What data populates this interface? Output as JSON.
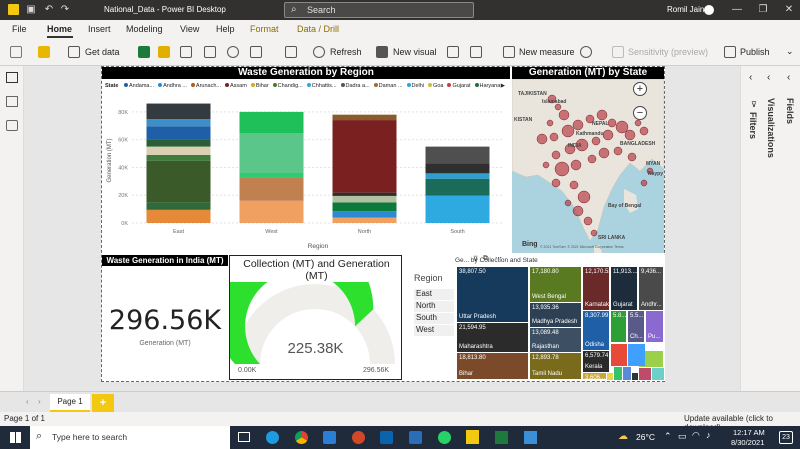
{
  "titlebar": {
    "title": "National_Data - Power BI Desktop",
    "search": "Search",
    "user": "Romil Jain"
  },
  "ribbon_tabs": [
    "File",
    "Home",
    "Insert",
    "Modeling",
    "View",
    "Help",
    "Format",
    "Data / Drill"
  ],
  "ribbon": {
    "get_data": "Get data",
    "refresh": "Refresh",
    "new_visual": "New visual",
    "new_measure": "New measure",
    "sensitivity": "Sensitivity (preview)",
    "publish": "Publish"
  },
  "panes": {
    "filters": "Filters",
    "visualizations": "Visualizations",
    "fields": "Fields"
  },
  "bar_visual": {
    "title": "Waste Generation by Region",
    "legend_label": "State",
    "legend_items": [
      "Andama...",
      "Andhra ...",
      "Arunach...",
      "Assam",
      "Bihar",
      "Chandig...",
      "Chhattis...",
      "Dadra a...",
      "Daman ...",
      "Delhi",
      "Goa",
      "Gujarat",
      "Haryana"
    ],
    "ylabel": "Generation (MT)",
    "xlabel": "Region",
    "yticks": [
      "80K",
      "60K",
      "40K",
      "20K",
      "0K"
    ]
  },
  "chart_data": {
    "type": "bar",
    "stacked": true,
    "categories": [
      "East",
      "West",
      "North",
      "South"
    ],
    "values": [
      86000,
      80000,
      78000,
      55000
    ],
    "ylim": [
      0,
      90000
    ],
    "xlabel": "Region",
    "ylabel": "Generation (MT)",
    "grid": true,
    "legend": "top"
  },
  "map_visual": {
    "title": "Generation (MT) by State",
    "labels": [
      "TAJIKISTAN",
      "KISTAN",
      "Islamabad",
      "NEPAL",
      "Kathmandu",
      "INDIA",
      "BANGLADESH",
      "MYAN",
      "Naypy",
      "Bay of Bengal",
      "SRI LANKA"
    ],
    "attribution": "© 2021 TomTom, © 2021 Microsoft Corporation Terms",
    "bing": "Bing",
    "zoom_in": "+",
    "zoom_out": "−"
  },
  "card_visual": {
    "title": "Waste Generation in India (MT)",
    "value": "296.56K",
    "label": "Generation (MT)"
  },
  "gauge_visual": {
    "title": "Collection (MT) and Generation (MT)",
    "value": "225.38K",
    "min": "0.00K",
    "max": "296.56K",
    "fraction": 0.76
  },
  "slicer": {
    "title": "Region",
    "items": [
      "East",
      "North",
      "South",
      "West"
    ]
  },
  "treemap_visual": {
    "title": "Ge... by Collection and State",
    "tiles": [
      {
        "value": "38,807.50",
        "label": "Uttar Pradesh",
        "color": "#163a5c"
      },
      {
        "value": "21,594.95",
        "label": "Maharashtra",
        "color": "#2b2b2b"
      },
      {
        "value": "18,813.80",
        "label": "Bihar",
        "color": "#7a4a2a"
      },
      {
        "value": "17,180.80",
        "label": "West Bengal",
        "color": "#5a7a22"
      },
      {
        "value": "13,935.36",
        "label": "Madhya Pradesh",
        "color": "#2e4154"
      },
      {
        "value": "13,089.48",
        "label": "Rajasthan",
        "color": "#3c4f63"
      },
      {
        "value": "12,893.78",
        "label": "Tamil Nadu",
        "color": "#7a6a1c"
      },
      {
        "value": "12,170.53",
        "label": "Karnataka",
        "color": "#6b2a2a"
      },
      {
        "value": "11,913....",
        "label": "Gujarat",
        "color": "#1d2c3a"
      },
      {
        "value": "9,436...",
        "label": "Andhr...",
        "color": "#4a4a4a"
      },
      {
        "value": "8,307.99",
        "label": "Odisha",
        "color": "#1f5fa8"
      },
      {
        "value": "6,579.74",
        "label": "Kerala",
        "color": "#2a2a2a"
      },
      {
        "value": "5.8...",
        "label": "",
        "color": "#2e9e36"
      },
      {
        "value": "5.5...",
        "label": "Ch...",
        "color": "#5a5a8a"
      },
      {
        "value": "",
        "label": "Pu...",
        "color": "#8a6ad0"
      },
      {
        "value": "3,606...",
        "label": "",
        "color": "#c8a638"
      }
    ]
  },
  "pagetabs": {
    "page": "Page 1",
    "add": "+"
  },
  "statusbar": {
    "left": "Page 1 of 1",
    "right": "Update available (click to download)"
  },
  "taskbar": {
    "search": "Type here to search",
    "weather": "26°C",
    "time": "12:17 AM",
    "date": "8/30/2021",
    "badge": "23"
  }
}
